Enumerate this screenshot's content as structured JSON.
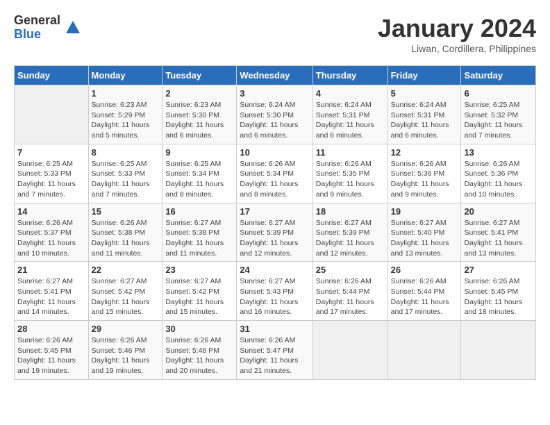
{
  "logo": {
    "general": "General",
    "blue": "Blue"
  },
  "title": "January 2024",
  "subtitle": "Liwan, Cordillera, Philippines",
  "days_of_week": [
    "Sunday",
    "Monday",
    "Tuesday",
    "Wednesday",
    "Thursday",
    "Friday",
    "Saturday"
  ],
  "weeks": [
    [
      {
        "day": "",
        "info": ""
      },
      {
        "day": "1",
        "info": "Sunrise: 6:23 AM\nSunset: 5:29 PM\nDaylight: 11 hours\nand 5 minutes."
      },
      {
        "day": "2",
        "info": "Sunrise: 6:23 AM\nSunset: 5:30 PM\nDaylight: 11 hours\nand 6 minutes."
      },
      {
        "day": "3",
        "info": "Sunrise: 6:24 AM\nSunset: 5:30 PM\nDaylight: 11 hours\nand 6 minutes."
      },
      {
        "day": "4",
        "info": "Sunrise: 6:24 AM\nSunset: 5:31 PM\nDaylight: 11 hours\nand 6 minutes."
      },
      {
        "day": "5",
        "info": "Sunrise: 6:24 AM\nSunset: 5:31 PM\nDaylight: 11 hours\nand 6 minutes."
      },
      {
        "day": "6",
        "info": "Sunrise: 6:25 AM\nSunset: 5:32 PM\nDaylight: 11 hours\nand 7 minutes."
      }
    ],
    [
      {
        "day": "7",
        "info": "Sunrise: 6:25 AM\nSunset: 5:33 PM\nDaylight: 11 hours\nand 7 minutes."
      },
      {
        "day": "8",
        "info": "Sunrise: 6:25 AM\nSunset: 5:33 PM\nDaylight: 11 hours\nand 7 minutes."
      },
      {
        "day": "9",
        "info": "Sunrise: 6:25 AM\nSunset: 5:34 PM\nDaylight: 11 hours\nand 8 minutes."
      },
      {
        "day": "10",
        "info": "Sunrise: 6:26 AM\nSunset: 5:34 PM\nDaylight: 11 hours\nand 8 minutes."
      },
      {
        "day": "11",
        "info": "Sunrise: 6:26 AM\nSunset: 5:35 PM\nDaylight: 11 hours\nand 9 minutes."
      },
      {
        "day": "12",
        "info": "Sunrise: 6:26 AM\nSunset: 5:36 PM\nDaylight: 11 hours\nand 9 minutes."
      },
      {
        "day": "13",
        "info": "Sunrise: 6:26 AM\nSunset: 5:36 PM\nDaylight: 11 hours\nand 10 minutes."
      }
    ],
    [
      {
        "day": "14",
        "info": "Sunrise: 6:26 AM\nSunset: 5:37 PM\nDaylight: 11 hours\nand 10 minutes."
      },
      {
        "day": "15",
        "info": "Sunrise: 6:26 AM\nSunset: 5:38 PM\nDaylight: 11 hours\nand 11 minutes."
      },
      {
        "day": "16",
        "info": "Sunrise: 6:27 AM\nSunset: 5:38 PM\nDaylight: 11 hours\nand 11 minutes."
      },
      {
        "day": "17",
        "info": "Sunrise: 6:27 AM\nSunset: 5:39 PM\nDaylight: 11 hours\nand 12 minutes."
      },
      {
        "day": "18",
        "info": "Sunrise: 6:27 AM\nSunset: 5:39 PM\nDaylight: 11 hours\nand 12 minutes."
      },
      {
        "day": "19",
        "info": "Sunrise: 6:27 AM\nSunset: 5:40 PM\nDaylight: 11 hours\nand 13 minutes."
      },
      {
        "day": "20",
        "info": "Sunrise: 6:27 AM\nSunset: 5:41 PM\nDaylight: 11 hours\nand 13 minutes."
      }
    ],
    [
      {
        "day": "21",
        "info": "Sunrise: 6:27 AM\nSunset: 5:41 PM\nDaylight: 11 hours\nand 14 minutes."
      },
      {
        "day": "22",
        "info": "Sunrise: 6:27 AM\nSunset: 5:42 PM\nDaylight: 11 hours\nand 15 minutes."
      },
      {
        "day": "23",
        "info": "Sunrise: 6:27 AM\nSunset: 5:42 PM\nDaylight: 11 hours\nand 15 minutes."
      },
      {
        "day": "24",
        "info": "Sunrise: 6:27 AM\nSunset: 5:43 PM\nDaylight: 11 hours\nand 16 minutes."
      },
      {
        "day": "25",
        "info": "Sunrise: 6:26 AM\nSunset: 5:44 PM\nDaylight: 11 hours\nand 17 minutes."
      },
      {
        "day": "26",
        "info": "Sunrise: 6:26 AM\nSunset: 5:44 PM\nDaylight: 11 hours\nand 17 minutes."
      },
      {
        "day": "27",
        "info": "Sunrise: 6:26 AM\nSunset: 5:45 PM\nDaylight: 11 hours\nand 18 minutes."
      }
    ],
    [
      {
        "day": "28",
        "info": "Sunrise: 6:26 AM\nSunset: 5:45 PM\nDaylight: 11 hours\nand 19 minutes."
      },
      {
        "day": "29",
        "info": "Sunrise: 6:26 AM\nSunset: 5:46 PM\nDaylight: 11 hours\nand 19 minutes."
      },
      {
        "day": "30",
        "info": "Sunrise: 6:26 AM\nSunset: 5:46 PM\nDaylight: 11 hours\nand 20 minutes."
      },
      {
        "day": "31",
        "info": "Sunrise: 6:26 AM\nSunset: 5:47 PM\nDaylight: 11 hours\nand 21 minutes."
      },
      {
        "day": "",
        "info": ""
      },
      {
        "day": "",
        "info": ""
      },
      {
        "day": "",
        "info": ""
      }
    ]
  ]
}
